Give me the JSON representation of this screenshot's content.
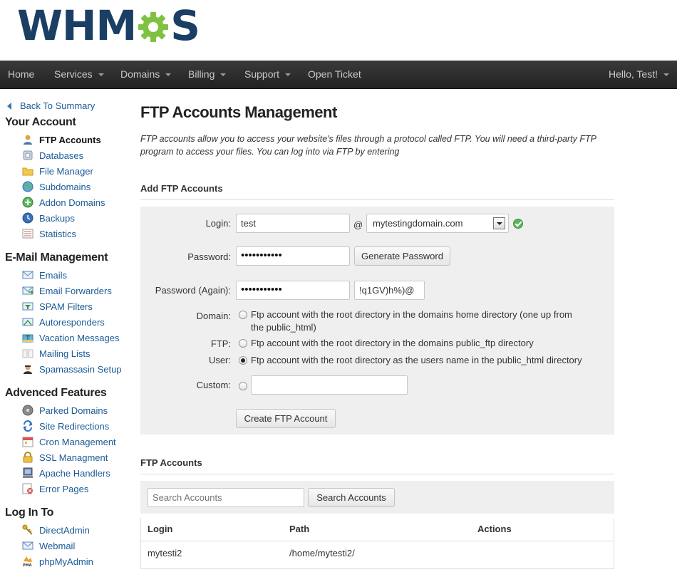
{
  "brand": {
    "logo_left": "WHM",
    "logo_right": "S"
  },
  "colors": {
    "brand_navy": "#1b3f64",
    "brand_green": "#7fc241",
    "link": "#1a5a96",
    "nav_bg": "#2b2b2b"
  },
  "nav": {
    "home": "Home",
    "services": "Services",
    "domains": "Domains",
    "billing": "Billing",
    "support": "Support",
    "open_ticket": "Open Ticket",
    "user": "Hello, Test!"
  },
  "sidebar": {
    "back": "Back To Summary",
    "your_account": {
      "heading": "Your Account",
      "items": [
        "FTP Accounts",
        "Databases",
        "File Manager",
        "Subdomains",
        "Addon Domains",
        "Backups",
        "Statistics"
      ]
    },
    "email": {
      "heading": "E-Mail Management",
      "items": [
        "Emails",
        "Email Forwarders",
        "SPAM Filters",
        "Autoresponders",
        "Vacation Messages",
        "Mailing Lists",
        "Spamassasin Setup"
      ]
    },
    "advanced": {
      "heading": "Advenced Features",
      "items": [
        "Parked Domains",
        "Site Redirections",
        "Cron Management",
        "SSL Managment",
        "Apache Handlers",
        "Error Pages"
      ]
    },
    "login": {
      "heading": "Log In To",
      "items": [
        "DirectAdmin",
        "Webmail",
        "phpMyAdmin"
      ]
    },
    "icons": {
      "ftp": "user-icon",
      "databases": "database-icon",
      "file_manager": "folder-icon",
      "subdomains": "globe-icon",
      "addon": "globe-plus-icon",
      "backups": "clock-icon",
      "stats": "chart-icon",
      "emails": "envelope-icon",
      "forwarders": "envelope-forward-icon",
      "spam": "filter-icon",
      "autoresponders": "autoreply-icon",
      "vacation": "palm-icon",
      "mailing": "book-icon",
      "spamassassin": "agent-icon",
      "parked": "disc-icon",
      "redirect": "arrows-icon",
      "cron": "clock-icon",
      "ssl": "lock-icon",
      "apache": "server-icon",
      "error": "error-page-icon",
      "directadmin": "key-icon",
      "webmail": "envelope-icon",
      "pma": "pma-icon"
    }
  },
  "main": {
    "title": "FTP Accounts Management",
    "intro": "FTP accounts allow you to access your website's files through a protocol called FTP. You will need a third-party FTP program to access your files. You can log into via FTP by entering",
    "add_section": "Add FTP Accounts",
    "form": {
      "login_label": "Login:",
      "login_value": "test",
      "at": "@",
      "domain_value": "mytestingdomain.com",
      "password_label": "Password:",
      "password_value": "•••••••••••",
      "generate_label": "Generate Password",
      "password_again_label": "Password (Again):",
      "password_again_value": "•••••••••••",
      "generated_value": "!q1GV)h%)@",
      "domain_label": "Domain:",
      "domain_option": "Ftp account with the root directory in the domains home directory (one up from",
      "domain_option_2": "the public_html)",
      "ftp_label": "FTP:",
      "ftp_option": "Ftp account with the root directory in the domains public_ftp directory",
      "user_label": "User:",
      "user_option": "Ftp account with the root directory as the users name in the public_html directory",
      "custom_label": "Custom:",
      "custom_value": "",
      "selected_option": "User",
      "create_label": "Create FTP Account"
    },
    "list_section": "FTP Accounts",
    "search": {
      "placeholder": "Search Accounts",
      "button": "Search Accounts"
    },
    "table": {
      "headers": [
        "Login",
        "Path",
        "Actions"
      ],
      "rows": [
        {
          "login": "mytesti2",
          "path": "/home/mytesti2/"
        }
      ]
    }
  }
}
